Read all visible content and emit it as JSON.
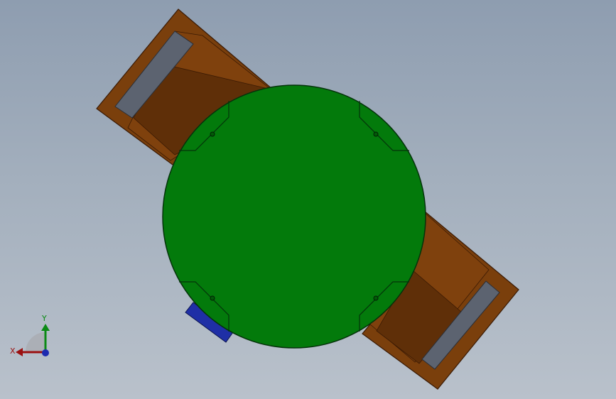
{
  "viewport": {
    "background_top": "#8e9db0",
    "background_bottom": "#b9c1cb"
  },
  "model": {
    "disk_color": "#037a0b",
    "bracket_color_light": "#7a3f0c",
    "bracket_color_dark": "#5c2d07",
    "pad_color": "#5c6370",
    "tab_color": "#1f2fa6"
  },
  "triad": {
    "x_label": "X",
    "y_label": "Y",
    "x_color": "#9b1010",
    "y_color": "#0a8a14",
    "z_color": "#1d2bb0"
  }
}
